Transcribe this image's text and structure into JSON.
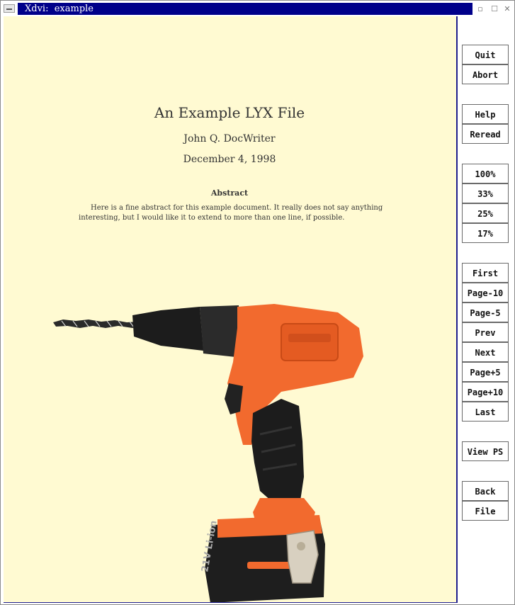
{
  "window": {
    "title": "Xdvi:  example",
    "controls": [
      "▫",
      "☐",
      "✕"
    ]
  },
  "document": {
    "title": "An Example LYX File",
    "author": "John Q. DocWriter",
    "date": "December 4, 1998",
    "abstract_heading": "Abstract",
    "abstract_line1": "Here is a fine abstract for this example document. It really does not say anything",
    "abstract_line2": "interesting, but I would like it to extend to more than one line, if possible.",
    "image": "cordless-drill"
  },
  "buttons": {
    "quit": "Quit",
    "abort": "Abort",
    "help": "Help",
    "reread": "Reread",
    "zoom100": "100%",
    "zoom33": "33%",
    "zoom25": "25%",
    "zoom17": "17%",
    "first": "First",
    "page_minus10": "Page-10",
    "page_minus5": "Page-5",
    "prev": "Prev",
    "next": "Next",
    "page_plus5": "Page+5",
    "page_plus10": "Page+10",
    "last": "Last",
    "view_ps": "View PS",
    "back": "Back",
    "file": "File"
  },
  "colors": {
    "title_bar": "#00008a",
    "page_background": "#fffad2",
    "drill_orange": "#f26a2e",
    "drill_black": "#1c1c1c"
  }
}
